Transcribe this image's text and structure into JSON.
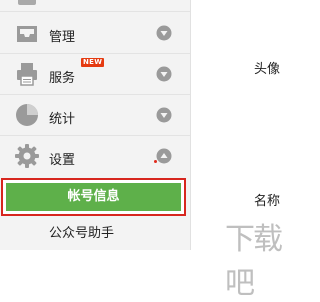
{
  "sidebar": {
    "items": [
      {
        "label": "管理",
        "icon": "inbox-icon"
      },
      {
        "label": "服务",
        "badge": "NEW",
        "icon": "printer-icon"
      },
      {
        "label": "统计",
        "icon": "pie-chart-icon"
      },
      {
        "label": "设置",
        "icon": "gear-icon"
      }
    ],
    "active_item": {
      "label": "帐号信息",
      "highlight_color": "#d7261e",
      "active_color": "#5eb04a"
    },
    "sub_item": {
      "label": "公众号助手"
    }
  },
  "content": {
    "avatar_label": "头像",
    "name_label": "名称"
  },
  "watermark": {
    "text": "下载吧"
  }
}
